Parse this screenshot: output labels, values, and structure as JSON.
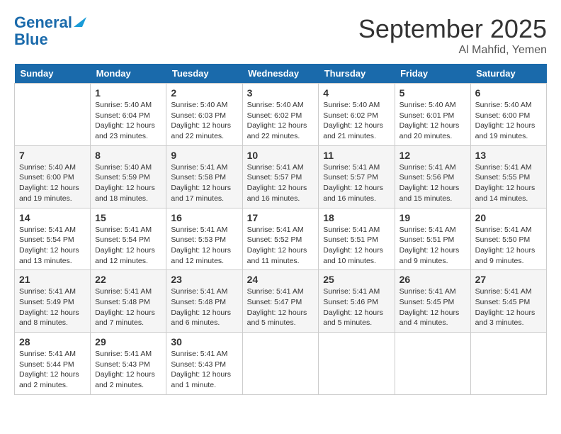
{
  "header": {
    "logo_line1": "General",
    "logo_line2": "Blue",
    "month": "September 2025",
    "location": "Al Mahfid, Yemen"
  },
  "days_of_week": [
    "Sunday",
    "Monday",
    "Tuesday",
    "Wednesday",
    "Thursday",
    "Friday",
    "Saturday"
  ],
  "weeks": [
    [
      {
        "day": "",
        "info": ""
      },
      {
        "day": "1",
        "info": "Sunrise: 5:40 AM\nSunset: 6:04 PM\nDaylight: 12 hours\nand 23 minutes."
      },
      {
        "day": "2",
        "info": "Sunrise: 5:40 AM\nSunset: 6:03 PM\nDaylight: 12 hours\nand 22 minutes."
      },
      {
        "day": "3",
        "info": "Sunrise: 5:40 AM\nSunset: 6:02 PM\nDaylight: 12 hours\nand 22 minutes."
      },
      {
        "day": "4",
        "info": "Sunrise: 5:40 AM\nSunset: 6:02 PM\nDaylight: 12 hours\nand 21 minutes."
      },
      {
        "day": "5",
        "info": "Sunrise: 5:40 AM\nSunset: 6:01 PM\nDaylight: 12 hours\nand 20 minutes."
      },
      {
        "day": "6",
        "info": "Sunrise: 5:40 AM\nSunset: 6:00 PM\nDaylight: 12 hours\nand 19 minutes."
      }
    ],
    [
      {
        "day": "7",
        "info": "Sunrise: 5:40 AM\nSunset: 6:00 PM\nDaylight: 12 hours\nand 19 minutes."
      },
      {
        "day": "8",
        "info": "Sunrise: 5:40 AM\nSunset: 5:59 PM\nDaylight: 12 hours\nand 18 minutes."
      },
      {
        "day": "9",
        "info": "Sunrise: 5:41 AM\nSunset: 5:58 PM\nDaylight: 12 hours\nand 17 minutes."
      },
      {
        "day": "10",
        "info": "Sunrise: 5:41 AM\nSunset: 5:57 PM\nDaylight: 12 hours\nand 16 minutes."
      },
      {
        "day": "11",
        "info": "Sunrise: 5:41 AM\nSunset: 5:57 PM\nDaylight: 12 hours\nand 16 minutes."
      },
      {
        "day": "12",
        "info": "Sunrise: 5:41 AM\nSunset: 5:56 PM\nDaylight: 12 hours\nand 15 minutes."
      },
      {
        "day": "13",
        "info": "Sunrise: 5:41 AM\nSunset: 5:55 PM\nDaylight: 12 hours\nand 14 minutes."
      }
    ],
    [
      {
        "day": "14",
        "info": "Sunrise: 5:41 AM\nSunset: 5:54 PM\nDaylight: 12 hours\nand 13 minutes."
      },
      {
        "day": "15",
        "info": "Sunrise: 5:41 AM\nSunset: 5:54 PM\nDaylight: 12 hours\nand 12 minutes."
      },
      {
        "day": "16",
        "info": "Sunrise: 5:41 AM\nSunset: 5:53 PM\nDaylight: 12 hours\nand 12 minutes."
      },
      {
        "day": "17",
        "info": "Sunrise: 5:41 AM\nSunset: 5:52 PM\nDaylight: 12 hours\nand 11 minutes."
      },
      {
        "day": "18",
        "info": "Sunrise: 5:41 AM\nSunset: 5:51 PM\nDaylight: 12 hours\nand 10 minutes."
      },
      {
        "day": "19",
        "info": "Sunrise: 5:41 AM\nSunset: 5:51 PM\nDaylight: 12 hours\nand 9 minutes."
      },
      {
        "day": "20",
        "info": "Sunrise: 5:41 AM\nSunset: 5:50 PM\nDaylight: 12 hours\nand 9 minutes."
      }
    ],
    [
      {
        "day": "21",
        "info": "Sunrise: 5:41 AM\nSunset: 5:49 PM\nDaylight: 12 hours\nand 8 minutes."
      },
      {
        "day": "22",
        "info": "Sunrise: 5:41 AM\nSunset: 5:48 PM\nDaylight: 12 hours\nand 7 minutes."
      },
      {
        "day": "23",
        "info": "Sunrise: 5:41 AM\nSunset: 5:48 PM\nDaylight: 12 hours\nand 6 minutes."
      },
      {
        "day": "24",
        "info": "Sunrise: 5:41 AM\nSunset: 5:47 PM\nDaylight: 12 hours\nand 5 minutes."
      },
      {
        "day": "25",
        "info": "Sunrise: 5:41 AM\nSunset: 5:46 PM\nDaylight: 12 hours\nand 5 minutes."
      },
      {
        "day": "26",
        "info": "Sunrise: 5:41 AM\nSunset: 5:45 PM\nDaylight: 12 hours\nand 4 minutes."
      },
      {
        "day": "27",
        "info": "Sunrise: 5:41 AM\nSunset: 5:45 PM\nDaylight: 12 hours\nand 3 minutes."
      }
    ],
    [
      {
        "day": "28",
        "info": "Sunrise: 5:41 AM\nSunset: 5:44 PM\nDaylight: 12 hours\nand 2 minutes."
      },
      {
        "day": "29",
        "info": "Sunrise: 5:41 AM\nSunset: 5:43 PM\nDaylight: 12 hours\nand 2 minutes."
      },
      {
        "day": "30",
        "info": "Sunrise: 5:41 AM\nSunset: 5:43 PM\nDaylight: 12 hours\nand 1 minute."
      },
      {
        "day": "",
        "info": ""
      },
      {
        "day": "",
        "info": ""
      },
      {
        "day": "",
        "info": ""
      },
      {
        "day": "",
        "info": ""
      }
    ]
  ]
}
